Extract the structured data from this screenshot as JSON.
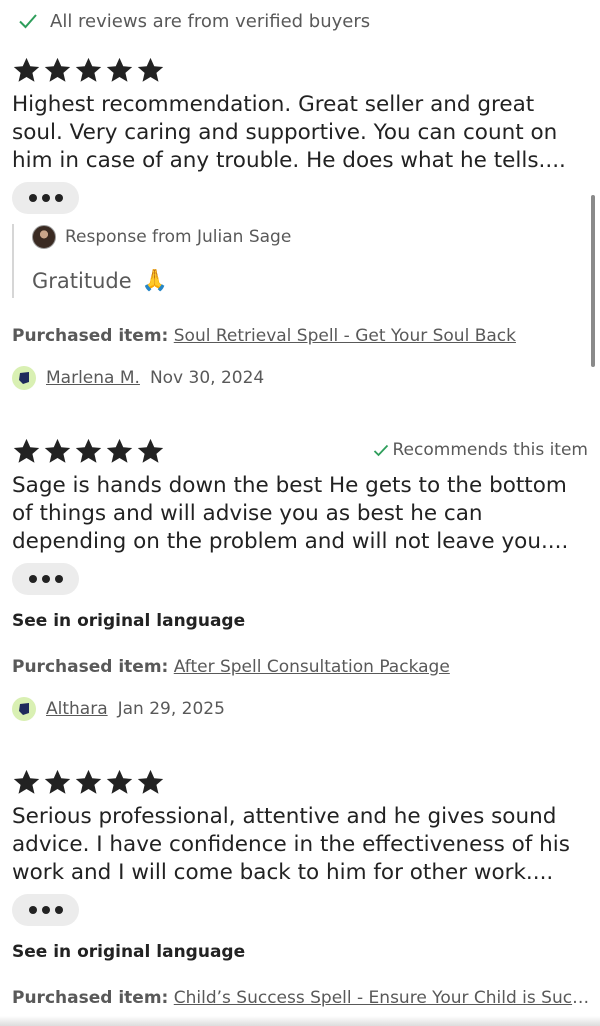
{
  "header": {
    "verified_text": "All reviews are from verified buyers"
  },
  "colors": {
    "text_primary": "#222222",
    "text_secondary": "#595959",
    "check_green": "#2e9e5b",
    "pill_bg": "#ececec",
    "avatar_badge_bg": "#d9f0b3"
  },
  "reviews": [
    {
      "rating": 5,
      "recommends_text": "",
      "text": "Highest recommendation. Great seller and great\nsoul. Very caring and supportive. You can count on\nhim in case of any trouble. He does what he tells....",
      "more_icon": "more-dots-icon",
      "response": {
        "header": "Response from Julian Sage",
        "text": "Gratitude",
        "emoji": "🙏"
      },
      "see_original_text": "",
      "purchased_label": "Purchased item:",
      "purchased_item": "Soul Retrieval Spell - Get Your Soul Back",
      "reviewer_name": "Marlena M.",
      "date": "Nov 30, 2024"
    },
    {
      "rating": 5,
      "recommends_text": "Recommends this item",
      "text": "Sage is hands down the best He gets to the bottom\nof things and will advise you as best he can\ndepending on the problem and will not leave you....",
      "more_icon": "more-dots-icon",
      "see_original_text": "See in original language",
      "purchased_label": "Purchased item:",
      "purchased_item": "After Spell Consultation Package",
      "reviewer_name": "Althara",
      "date": "Jan 29, 2025"
    },
    {
      "rating": 5,
      "recommends_text": "",
      "text": "Serious professional, attentive and he gives sound\nadvice. I have confidence in the effectiveness of his\nwork and I will come back to him for other work....",
      "more_icon": "more-dots-icon",
      "see_original_text": "See in original language",
      "purchased_label": "Purchased item:",
      "purchased_item": "Child’s Success Spell - Ensure Your Child is Successful"
    }
  ]
}
